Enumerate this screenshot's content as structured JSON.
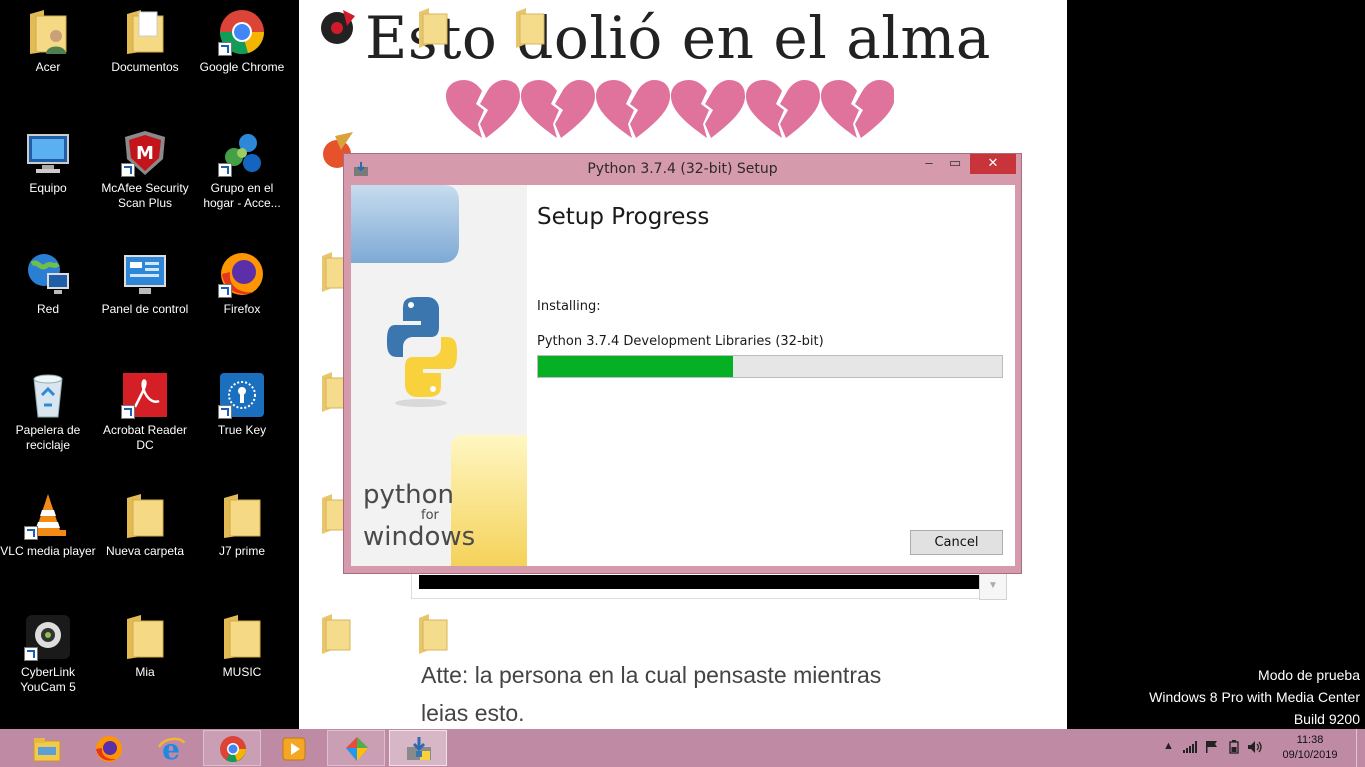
{
  "desktop": {
    "icons": [
      {
        "label": "Acer"
      },
      {
        "label": "Documentos"
      },
      {
        "label": "Google Chrome"
      },
      {
        "label": "Equipo"
      },
      {
        "label": "McAfee Security Scan Plus"
      },
      {
        "label": "Grupo en el hogar - Acce..."
      },
      {
        "label": "Red"
      },
      {
        "label": "Panel de control"
      },
      {
        "label": "Firefox"
      },
      {
        "label": "Papelera de reciclaje"
      },
      {
        "label": "Acrobat Reader DC"
      },
      {
        "label": "True Key"
      },
      {
        "label": "VLC media player"
      },
      {
        "label": "Nueva carpeta"
      },
      {
        "label": "J7 prime"
      },
      {
        "label": "CyberLink YouCam 5"
      },
      {
        "label": "Mia"
      },
      {
        "label": "MUSIC"
      }
    ]
  },
  "wallpaper": {
    "title": "Esto dolió en el alma",
    "message_line1": "Atte: la persona en la cual pensaste mientras",
    "message_line2": "leias esto."
  },
  "watermark": {
    "line1": "Modo de prueba",
    "line2": "Windows 8 Pro with Media Center",
    "line3": "Build 9200"
  },
  "window": {
    "title": "Python 3.7.4 (32-bit) Setup",
    "heading": "Setup Progress",
    "installing_label": "Installing:",
    "component": "Python 3.7.4 Development Libraries (32-bit)",
    "progress_fraction": 0.42,
    "cancel_label": "Cancel",
    "brand": {
      "l1": "python",
      "l2": "for",
      "l3": "windows"
    },
    "min_glyph": "–",
    "max_glyph": "▭",
    "close_glyph": "✕"
  },
  "taskbar": {
    "items": [
      {
        "icon": "file-explorer-icon",
        "state": "normal"
      },
      {
        "icon": "firefox-icon",
        "state": "normal"
      },
      {
        "icon": "internet-explorer-icon",
        "state": "normal"
      },
      {
        "icon": "chrome-icon",
        "state": "open"
      },
      {
        "icon": "media-player-icon",
        "state": "normal"
      },
      {
        "icon": "paint-app-icon",
        "state": "open"
      },
      {
        "icon": "python-installer-icon",
        "state": "active"
      }
    ],
    "time": "11:38",
    "date": "09/10/2019"
  },
  "colors": {
    "taskbar": "#bf8aa4",
    "window_frame": "#d59aac",
    "progress_green": "#06b025",
    "close_red": "#c7343a"
  }
}
